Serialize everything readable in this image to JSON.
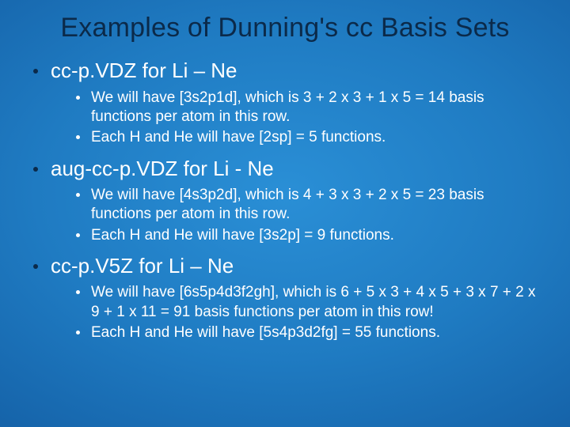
{
  "title": "Examples of Dunning's cc Basis Sets",
  "items": [
    {
      "heading": "cc-p.VDZ for Li – Ne",
      "sub": [
        "We will have [3s2p1d], which is 3 + 2 x 3 + 1 x 5 = 14 basis functions per atom in this row.",
        "Each H and He will have [2sp] = 5 functions."
      ]
    },
    {
      "heading": "aug-cc-p.VDZ for Li - Ne",
      "sub": [
        "We will have [4s3p2d], which is 4 + 3 x 3 + 2 x 5 = 23 basis functions per atom in this row.",
        "Each H and He will have [3s2p] = 9 functions."
      ]
    },
    {
      "heading": "cc-p.V5Z for Li – Ne",
      "sub": [
        "We will have [6s5p4d3f2gh], which is 6 + 5 x 3 + 4 x 5 + 3 x 7 + 2 x 9 + 1 x 11 = 91 basis functions per atom in this row!",
        "Each H and He will have [5s4p3d2fg] = 55 functions."
      ]
    }
  ]
}
